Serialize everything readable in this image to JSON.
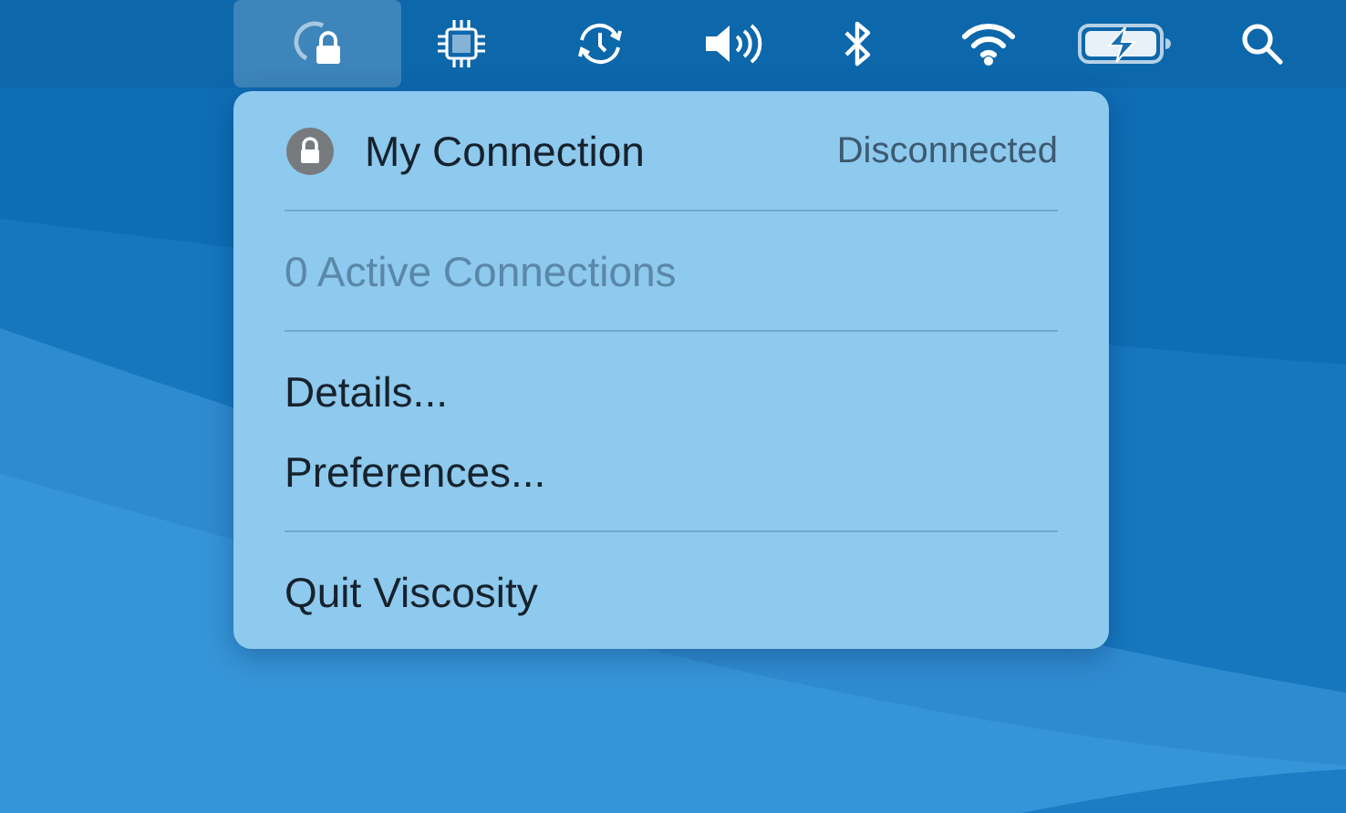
{
  "menu_bar": {
    "items": [
      {
        "kind": "vpn",
        "selected": true
      },
      {
        "kind": "cpu",
        "selected": false
      },
      {
        "kind": "time-machine",
        "selected": false
      },
      {
        "kind": "volume",
        "selected": false
      },
      {
        "kind": "bluetooth",
        "selected": false
      },
      {
        "kind": "wifi",
        "selected": false
      },
      {
        "kind": "battery",
        "selected": false
      },
      {
        "kind": "search",
        "selected": false
      }
    ]
  },
  "menu": {
    "sections": [
      {
        "items": [
          {
            "kind": "connection",
            "label": "My Connection",
            "status": "Disconnected",
            "disabled": false
          }
        ]
      },
      {
        "items": [
          {
            "kind": "item",
            "label": "0 Active Connections",
            "disabled": true
          }
        ]
      },
      {
        "items": [
          {
            "kind": "item",
            "label": "Details...",
            "disabled": false
          },
          {
            "kind": "item",
            "label": "Preferences...",
            "disabled": false
          }
        ]
      },
      {
        "items": [
          {
            "kind": "item",
            "label": "Quit Viscosity",
            "disabled": false
          }
        ]
      }
    ]
  }
}
